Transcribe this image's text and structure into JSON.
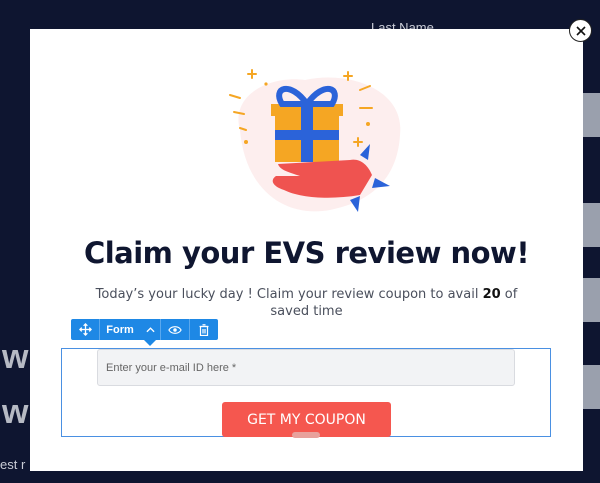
{
  "background": {
    "field_label": "Last Name",
    "big_letters": [
      "w",
      "w"
    ],
    "small_text": "est r"
  },
  "popup": {
    "headline": "Claim your EVS review now!",
    "subtext_before": "Today’s your lucky day ! Claim your review coupon to avail ",
    "subtext_bold": "20",
    "subtext_after": " of saved time",
    "email_placeholder": "Enter your e-mail ID here *",
    "cta_label": "GET MY COUPON",
    "close_icon": "close-icon",
    "illustration": "gift-box-in-hand"
  },
  "toolbar": {
    "form_label": "Form",
    "icons": [
      "move-icon",
      "chevron-up-icon",
      "eye-icon",
      "trash-icon"
    ]
  },
  "colors": {
    "page_bg": "#0e1530",
    "cta": "#f5574f",
    "toolbar": "#1e88e5",
    "gift_box": "#f5a623",
    "ribbon": "#2b63d9",
    "hand": "#ef5350"
  }
}
